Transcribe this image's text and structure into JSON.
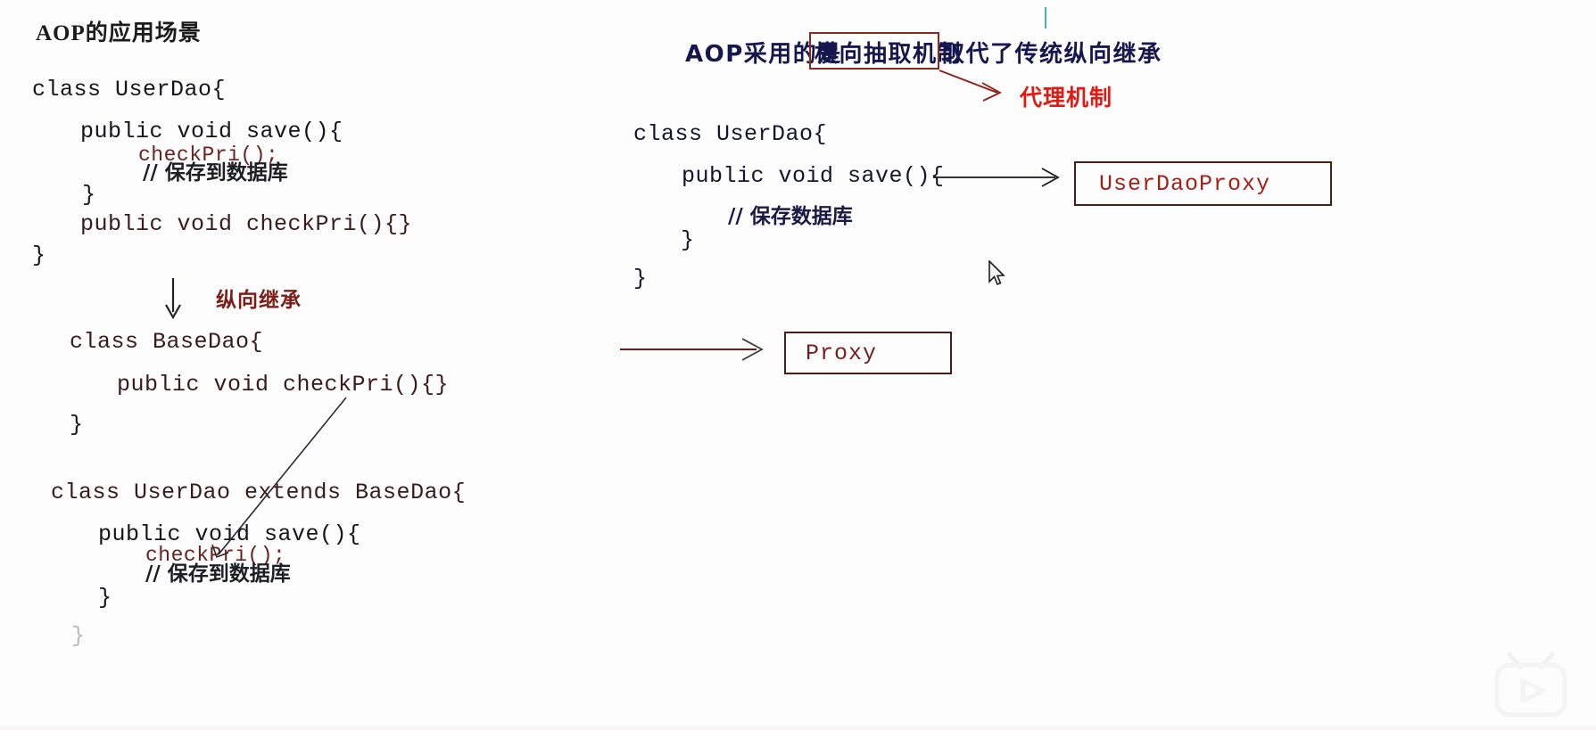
{
  "meta": {
    "bg_color": "#fdfdfd",
    "accent_red": "#e01b14",
    "dark_red": "#7c1d18",
    "navy": "#17174f"
  },
  "left_panel": {
    "heading": "AOP的应用场景",
    "code_block_1": [
      {
        "text": "class UserDao{",
        "style": "dark"
      },
      {
        "text": "public void save(){",
        "style": "dark"
      },
      {
        "text": "checkPri();",
        "style": "red"
      },
      {
        "text": "// 保存到数据库",
        "style": "comment"
      },
      {
        "text": "}",
        "style": "dark"
      },
      {
        "text": "public void checkPri(){}",
        "style": "maroon"
      },
      {
        "text": "}",
        "style": "dark"
      }
    ],
    "inheritance_label": "纵向继承",
    "code_block_2": [
      {
        "text": "class BaseDao{",
        "style": "maroon"
      },
      {
        "text": "public void checkPri(){}",
        "style": "maroon"
      },
      {
        "text": "}",
        "style": "dark"
      }
    ],
    "code_block_3": [
      {
        "text": "class UserDao extends BaseDao{",
        "style": "maroon"
      },
      {
        "text": "public void save(){",
        "style": "dark"
      },
      {
        "text": "checkPri();",
        "style": "red"
      },
      {
        "text": "// 保存到数据库",
        "style": "comment"
      },
      {
        "text": "}",
        "style": "dark"
      },
      {
        "text": "}",
        "style": "dark"
      }
    ]
  },
  "right_panel": {
    "title_parts": {
      "before": "AOP采用的是",
      "highlighted": "横向抽取机制",
      "after": "取代了传统纵向继承"
    },
    "proxy_mechanism_label": "代理机制",
    "code_block": [
      {
        "text": "class UserDao{",
        "style": "navy"
      },
      {
        "text": "public void save(){",
        "style": "navy"
      },
      {
        "text": "// 保存数据库",
        "style": "comment"
      },
      {
        "text": "}",
        "style": "navy"
      },
      {
        "text": "}",
        "style": "navy"
      }
    ],
    "boxes": [
      {
        "label": "UserDaoProxy",
        "name": "userdaoproxy-box"
      },
      {
        "label": "Proxy",
        "name": "proxy-box"
      }
    ]
  }
}
